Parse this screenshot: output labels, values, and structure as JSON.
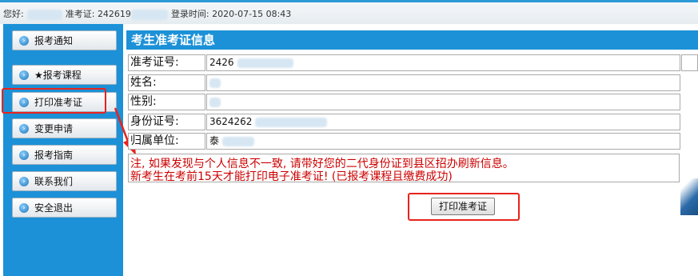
{
  "topbar": {
    "greeting_label": "您好:",
    "exam_no_label": "准考证:",
    "exam_no_prefix": "242619",
    "login_time_label": "登录时间:",
    "login_time": "2020-07-15 08:43"
  },
  "sidebar": {
    "items": [
      {
        "label": "报考通知"
      },
      {
        "label": "★报考课程"
      },
      {
        "label": "打印准考证"
      },
      {
        "label": "变更申请"
      },
      {
        "label": "报考指南"
      },
      {
        "label": "联系我们"
      },
      {
        "label": "安全退出"
      }
    ]
  },
  "panel": {
    "title": "考生准考证信息",
    "rows": [
      {
        "label": "准考证号:",
        "value": "2426"
      },
      {
        "label": "姓名:",
        "value": ""
      },
      {
        "label": "性别:",
        "value": ""
      },
      {
        "label": "身份证号:",
        "value": "3624262"
      },
      {
        "label": "归属单位:",
        "value": "泰"
      }
    ],
    "notice_line1": "注, 如果发现与个人信息不一致, 请带好您的二代身份证到县区招办刷新信息。",
    "notice_line2": "新考生在考前15天才能打印电子准考证! (已报考课程且缴费成功)",
    "print_button": "打印准考证"
  },
  "colors": {
    "accent": "#1c91d7",
    "highlight": "#e8231d",
    "notice": "#cc0000"
  }
}
